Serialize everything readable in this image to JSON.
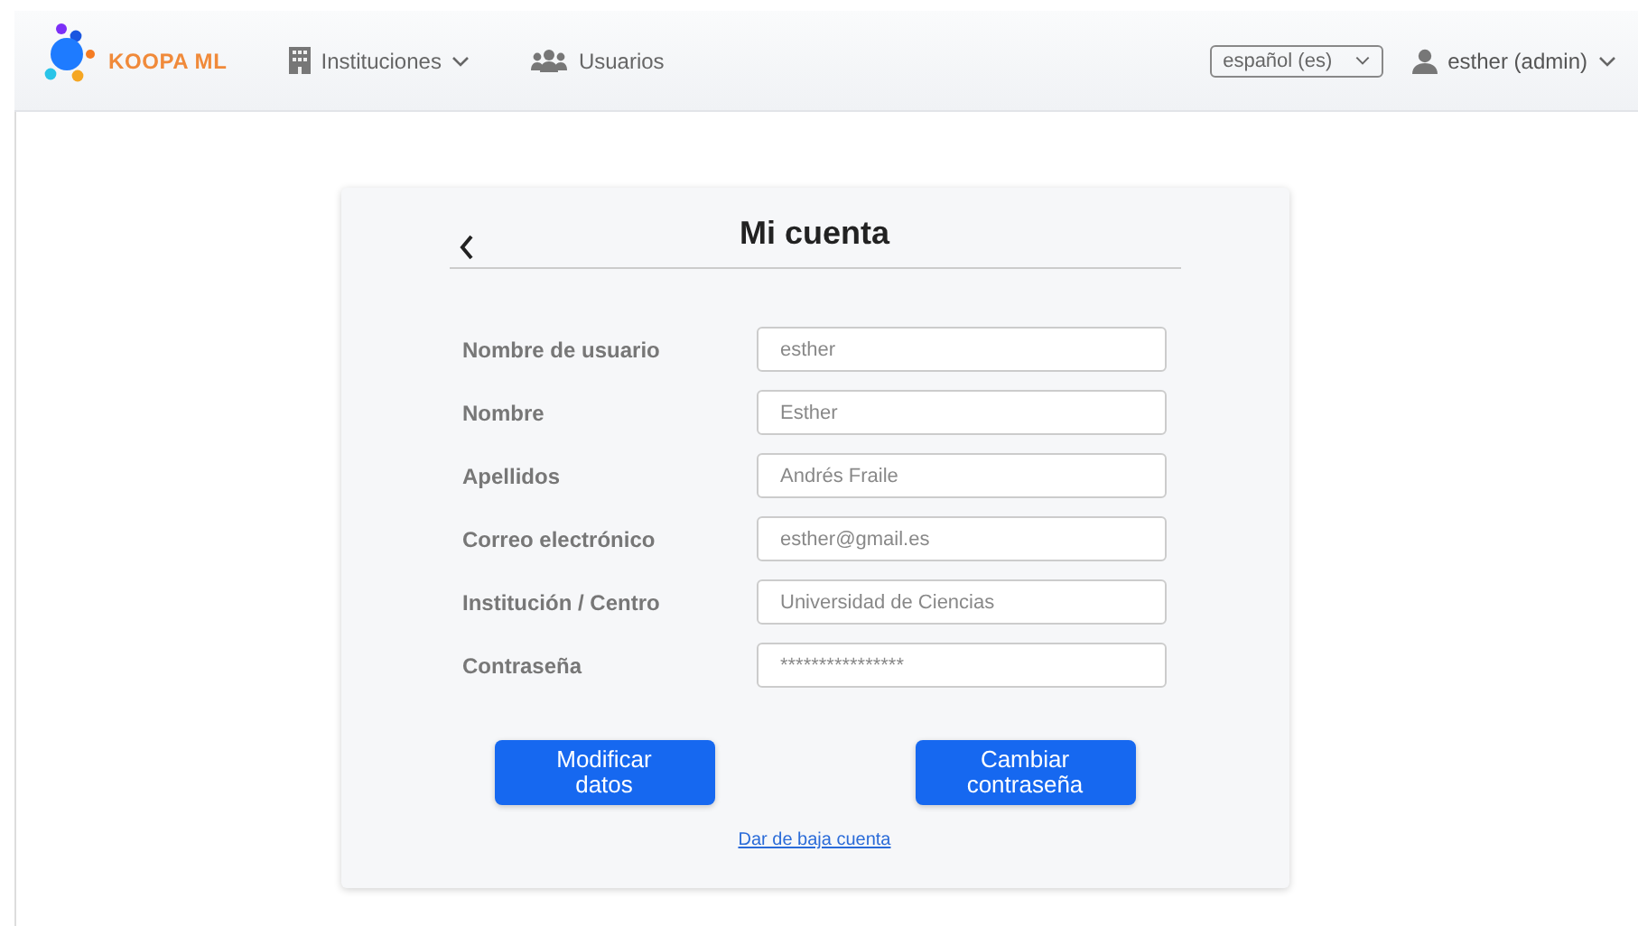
{
  "navbar": {
    "brand": "KOOPA ML",
    "menu": [
      {
        "label": "Instituciones",
        "kind": "building",
        "dropdown": true
      },
      {
        "label": "Usuarios",
        "kind": "users",
        "dropdown": false
      }
    ],
    "language": "español (es)",
    "user": "esther (admin)"
  },
  "card": {
    "title": "Mi cuenta",
    "fields": [
      {
        "label": "Nombre de usuario",
        "value": "esther"
      },
      {
        "label": "Nombre",
        "value": "Esther"
      },
      {
        "label": "Apellidos",
        "value": "Andrés Fraile"
      },
      {
        "label": "Correo electrónico",
        "value": "esther@gmail.es"
      },
      {
        "label": "Institución / Centro",
        "value": "Universidad de Ciencias"
      },
      {
        "label": "Contraseña",
        "value": "****************"
      }
    ],
    "buttons": [
      "Modificar datos",
      "Cambiar contraseña"
    ],
    "link": "Dar de baja cuenta"
  }
}
